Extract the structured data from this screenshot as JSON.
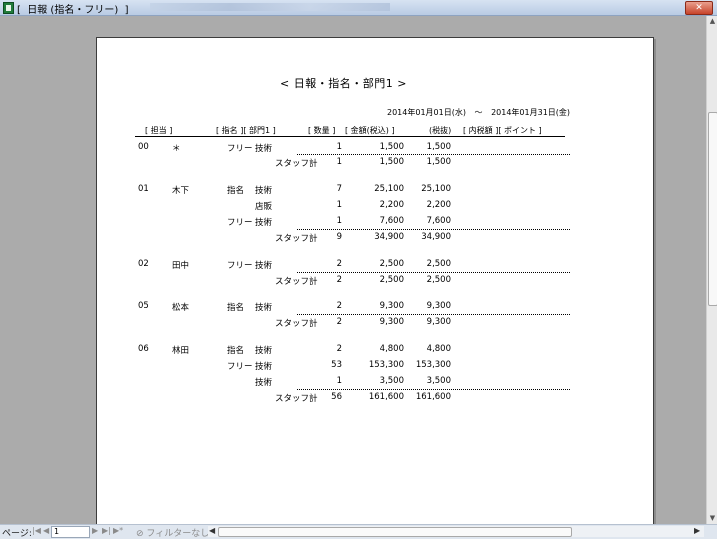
{
  "window": {
    "title": "[  日報 (指名・フリー)  ]"
  },
  "report": {
    "title": "<  日報・指名・部門1  >",
    "date_from": "2014年01月01日(水)",
    "tilde": "〜",
    "date_to": "2014年01月31日(金)",
    "headers": {
      "staff": "[ 担当 ]",
      "type_dept": "[ 指名 ][ 部門1 ]",
      "qty": "[ 数量 ]",
      "amount": "[ 金額(税込) ]",
      "net": "(税抜)",
      "tax_point": "[ 内税額 ][ ポイント ]"
    },
    "rows": [
      {
        "code": "00",
        "name": "＊",
        "type": "フリー",
        "dept": "技術",
        "qty": "1",
        "amount": "1,500",
        "net": "1,500"
      },
      {
        "code": "",
        "name": "",
        "type": "",
        "dept": "スタッフ計",
        "qty": "1",
        "amount": "1,500",
        "net": "1,500"
      },
      {
        "code": "01",
        "name": "木下",
        "type": "指名",
        "dept": "技術",
        "qty": "7",
        "amount": "25,100",
        "net": "25,100"
      },
      {
        "code": "",
        "name": "",
        "type": "",
        "dept": "店販",
        "qty": "1",
        "amount": "2,200",
        "net": "2,200"
      },
      {
        "code": "",
        "name": "",
        "type": "フリー",
        "dept": "技術",
        "qty": "1",
        "amount": "7,600",
        "net": "7,600"
      },
      {
        "code": "",
        "name": "",
        "type": "",
        "dept": "スタッフ計",
        "qty": "9",
        "amount": "34,900",
        "net": "34,900"
      },
      {
        "code": "02",
        "name": "田中",
        "type": "フリー",
        "dept": "技術",
        "qty": "2",
        "amount": "2,500",
        "net": "2,500"
      },
      {
        "code": "",
        "name": "",
        "type": "",
        "dept": "スタッフ計",
        "qty": "2",
        "amount": "2,500",
        "net": "2,500"
      },
      {
        "code": "05",
        "name": "松本",
        "type": "指名",
        "dept": "技術",
        "qty": "2",
        "amount": "9,300",
        "net": "9,300"
      },
      {
        "code": "",
        "name": "",
        "type": "",
        "dept": "スタッフ計",
        "qty": "2",
        "amount": "9,300",
        "net": "9,300"
      },
      {
        "code": "06",
        "name": "林田",
        "type": "指名",
        "dept": "技術",
        "qty": "2",
        "amount": "4,800",
        "net": "4,800"
      },
      {
        "code": "",
        "name": "",
        "type": "フリー",
        "dept": "技術",
        "qty": "53",
        "amount": "153,300",
        "net": "153,300"
      },
      {
        "code": "",
        "name": "",
        "type": "",
        "dept": "技術",
        "qty": "1",
        "amount": "3,500",
        "net": "3,500"
      },
      {
        "code": "",
        "name": "",
        "type": "",
        "dept": "スタッフ計",
        "qty": "56",
        "amount": "161,600",
        "net": "161,600"
      }
    ]
  },
  "statusbar": {
    "page_label": "ページ:",
    "page_value": "1",
    "first_icon": "first-page-icon",
    "prev_icon": "prev-page-icon",
    "next_icon": "next-page-icon",
    "last_icon": "last-page-icon",
    "filter_label": "フィルターなし"
  },
  "colors": {
    "title_bar": "#c8d7ec",
    "viewer_bg": "#ababab",
    "page_bg": "#ffffff",
    "close_button": "#c7432a"
  }
}
